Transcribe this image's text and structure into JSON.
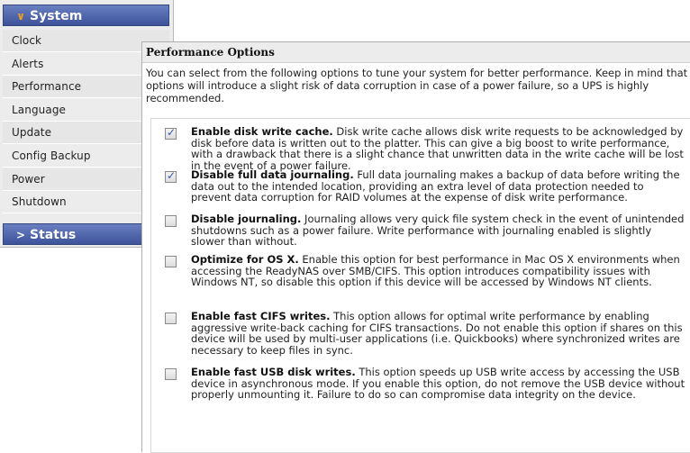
{
  "sidebar": {
    "system_label": "System",
    "status_label": "Status",
    "items": [
      {
        "label": "Clock"
      },
      {
        "label": "Alerts"
      },
      {
        "label": "Performance"
      },
      {
        "label": "Language"
      },
      {
        "label": "Update"
      },
      {
        "label": "Config Backup"
      },
      {
        "label": "Power"
      },
      {
        "label": "Shutdown"
      }
    ]
  },
  "panel": {
    "title": "Performance Options",
    "intro": "You can select from the following options to tune your system for better performance. Keep in mind that these options will introduce a slight risk of data corruption in case of a power failure, so a UPS is highly recommended."
  },
  "options": [
    {
      "checked": true,
      "title": "Enable disk write cache.",
      "desc": " Disk write cache allows disk write requests to be acknowledged by disk before data is written out to the platter. This can give a big boost to write performance, with a drawback that there is a slight chance that unwritten data in the write cache will be lost in the event of a power failure."
    },
    {
      "checked": true,
      "title": "Disable full data journaling.",
      "desc": " Full data journaling makes a backup of data before writing the data out to the intended location, providing an extra level of data protection needed to prevent data corruption for RAID volumes at the expense of disk write performance."
    },
    {
      "checked": false,
      "title": "Disable journaling.",
      "desc": " Journaling allows very quick file system check in the event of unintended shutdowns such as a power failure. Write performance with journaling enabled is slightly slower than without."
    },
    {
      "checked": false,
      "title": "Optimize for OS X.",
      "desc": " Enable this option for best performance in Mac OS X environments when accessing the ReadyNAS over SMB/CIFS. This option introduces compatibility issues with Windows NT, so disable this option if this device will be accessed by Windows NT clients."
    },
    {
      "checked": false,
      "title": "Enable fast CIFS writes.",
      "desc": " This option allows for optimal write performance by enabling aggressive write-back caching for CIFS transactions. Do not enable this option if shares on this device will be used by multi-user applications (i.e. Quickbooks) where synchronized writes are necessary to keep files in sync."
    },
    {
      "checked": false,
      "title": "Enable fast USB disk writes.",
      "desc": " This option speeds up USB write access by accessing the USB device in asynchronous mode. If you enable this option, do not remove the USB device without properly unmounting it. Failure to do so can compromise data integrity on the device."
    }
  ]
}
